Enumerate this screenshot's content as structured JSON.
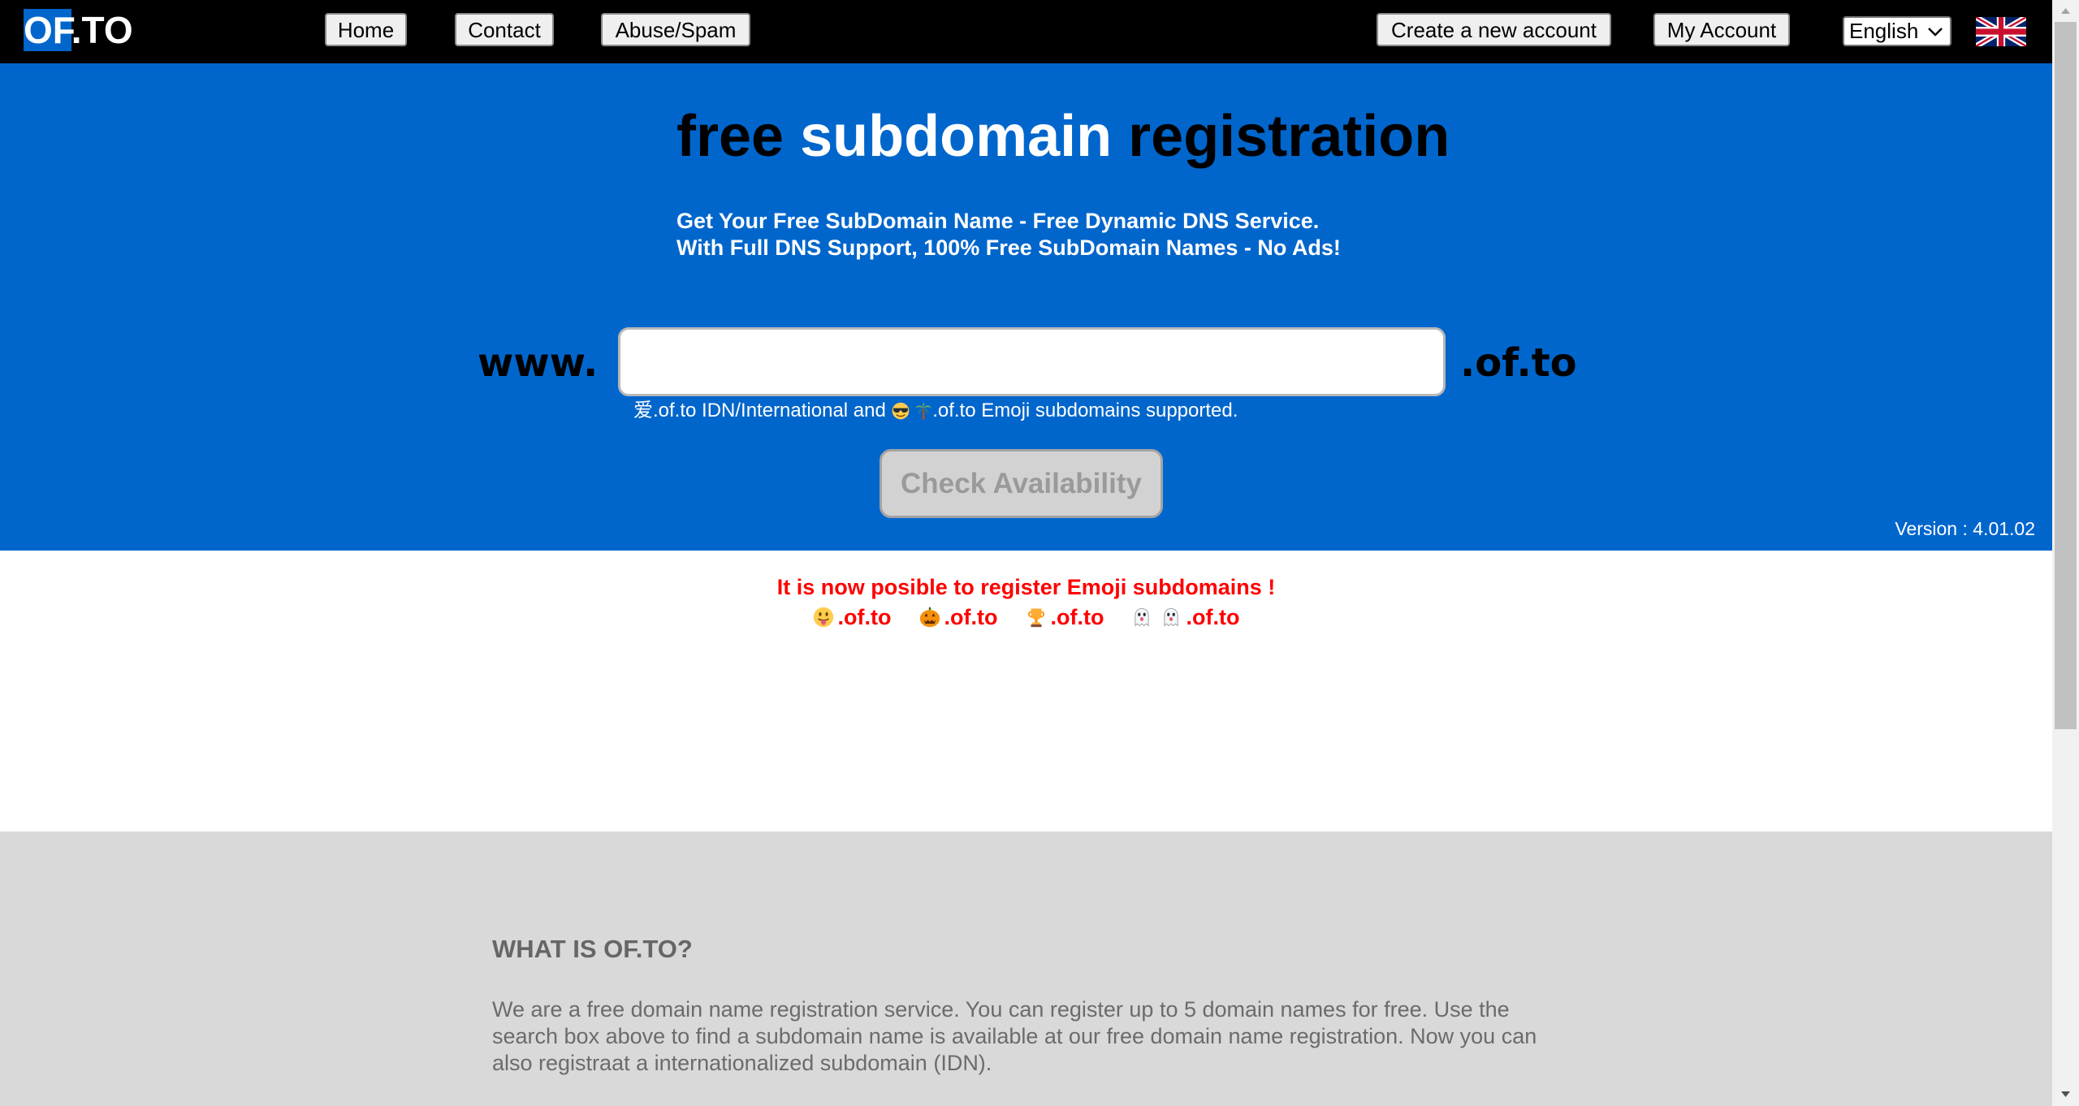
{
  "nav": {
    "logo": {
      "highlight": "OF",
      "rest": ".TO"
    },
    "links": [
      {
        "label": "Home"
      },
      {
        "label": "Contact"
      },
      {
        "label": "Abuse/Spam"
      }
    ],
    "account_links": [
      {
        "label": "Create a new account"
      },
      {
        "label": "My Account"
      }
    ],
    "language": {
      "selected": "English",
      "icon": "chevron-down-icon"
    },
    "flag_icon": "uk-flag-icon"
  },
  "hero": {
    "title": {
      "part1": "free",
      "part2": "subdomain",
      "part3": "registration"
    },
    "subtitle_line1": "Get Your Free SubDomain Name - Free Dynamic DNS Service.",
    "subtitle_line2": "With Full DNS Support, 100% Free SubDomain Names - No Ads!",
    "prefix": "www.",
    "suffix": ".of.to",
    "domain_input": {
      "value": ""
    },
    "idn_note": {
      "idn_char": "爱",
      "text1": ".of.to IDN/International and",
      "emoji_icons": [
        "smiling-face-with-sunglasses-icon",
        "palm-tree-icon"
      ],
      "text2": ".of.to Emoji subdomains supported."
    },
    "check_button": "Check Availability",
    "version": "Version : 4.01.02"
  },
  "announcement": {
    "title": "It is now posible to register Emoji subdomains !",
    "examples": [
      {
        "icons": [
          "face-with-tongue-icon"
        ],
        "domain": ".of.to"
      },
      {
        "icons": [
          "jack-o-lantern-icon"
        ],
        "domain": ".of.to"
      },
      {
        "icons": [
          "trophy-icon"
        ],
        "domain": ".of.to"
      },
      {
        "icons": [
          "ghost-icon",
          "ghost-icon"
        ],
        "domain": ".of.to"
      }
    ]
  },
  "about": {
    "heading": "WHAT IS OF.TO?",
    "body": "We are a free domain name registration service. You can register up to 5 domain names for free. Use the search box above to find a subdomain name is available at our free domain name registration. Now you can also registraat a internationalized subdomain (IDN)."
  },
  "colors": {
    "nav_background": "#000000",
    "hero_background": "#0066CC",
    "logo_highlight": "#0066CC",
    "announcement_text": "#FF0000",
    "about_background": "#D9D9D9",
    "about_text": "#666666"
  }
}
